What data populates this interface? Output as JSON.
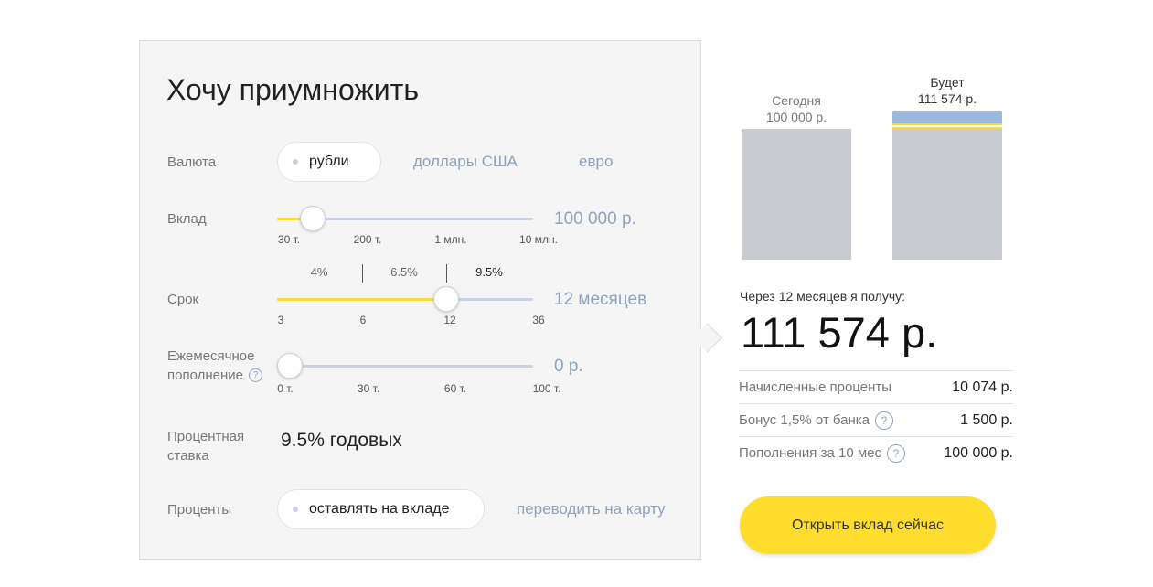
{
  "title": "Хочу приумножить",
  "currency": {
    "label": "Валюта",
    "selected": "рубли",
    "options": [
      "доллары США",
      "евро"
    ]
  },
  "deposit": {
    "label": "Вклад",
    "value": "100 000 р.",
    "ticks": [
      "30 т.",
      "200 т.",
      "1 млн.",
      "10 млн."
    ],
    "slider_fraction": 0.14
  },
  "term": {
    "label": "Срок",
    "value": "12 месяцев",
    "ticks": [
      "3",
      "6",
      "12",
      "36"
    ],
    "rate_ticks": [
      "4%",
      "6.5%",
      "9.5%"
    ],
    "slider_fraction": 0.66
  },
  "monthly": {
    "label_line1": "Ежемесячное",
    "label_line2": "пополнение",
    "help": "?",
    "value": "0 р.",
    "ticks": [
      "0 т.",
      "30 т.",
      "60 т.",
      "100 т."
    ],
    "slider_fraction": 0.0
  },
  "rate": {
    "label_line1": "Процентная",
    "label_line2": "ставка",
    "value": "9.5% годовых"
  },
  "interest": {
    "label": "Проценты",
    "selected": "оставлять на вкладе",
    "alternative": "переводить на карту"
  },
  "bars": {
    "today_label": "Сегодня",
    "today_value": "100 000 р.",
    "future_label": "Будет",
    "future_value": "111 574 р."
  },
  "result": {
    "caption": "Через 12 месяцев я получу:",
    "amount": "111 574 р."
  },
  "summary": [
    {
      "label": "Начисленные проценты",
      "value": "10 074 р.",
      "help": ""
    },
    {
      "label": "Бонус 1,5% от банка",
      "value": "1 500 р.",
      "help": "?"
    },
    {
      "label": "Пополнения за 10 мес",
      "value": "100 000 р.",
      "help": "?"
    }
  ],
  "cta": "Открыть вклад сейчас",
  "colors": {
    "accent": "#ffdd2d",
    "link": "#8ea3bd",
    "slider_fill": "#f6dc3a",
    "track": "#c9d3e3",
    "bar": "#c8cbcf",
    "bar_top": "#9cb8dc"
  }
}
